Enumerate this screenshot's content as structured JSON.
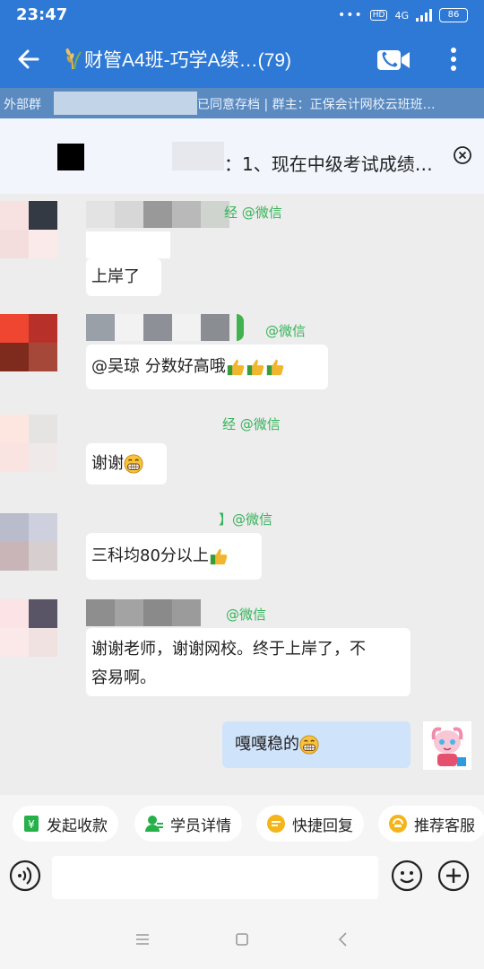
{
  "status": {
    "time": "23:47",
    "network": "4G",
    "hd": "HD",
    "battery": "86"
  },
  "header": {
    "title": "财管A4班-巧学A续…(79)",
    "notice_left": "外部群",
    "notice_right": "已同意存档 | 群主：正保会计网校云班班…"
  },
  "announcement": {
    "text": "：1、现在中级考试成绩…"
  },
  "messages": [
    {
      "wechat_label": "经 @微信",
      "text": "上岸了"
    },
    {
      "wechat_label": "@微信",
      "text": "@吴琼 分数好高哦"
    },
    {
      "wechat_label": "经 @微信",
      "text": "谢谢"
    },
    {
      "wechat_label": "】@微信",
      "text": "三科均80分以上"
    },
    {
      "wechat_label": "@微信",
      "text_line1": "谢谢老师，谢谢网校。终于上岸了，不",
      "text_line2": "容易啊。"
    },
    {
      "text": "嘎嘎稳的"
    }
  ],
  "quick_actions": [
    "发起收款",
    "学员详情",
    "快捷回复",
    "推荐客服"
  ],
  "colors": {
    "brand": "#2d79d5",
    "wechat_green": "#36b35a",
    "my_bubble": "#cfe3fb"
  }
}
